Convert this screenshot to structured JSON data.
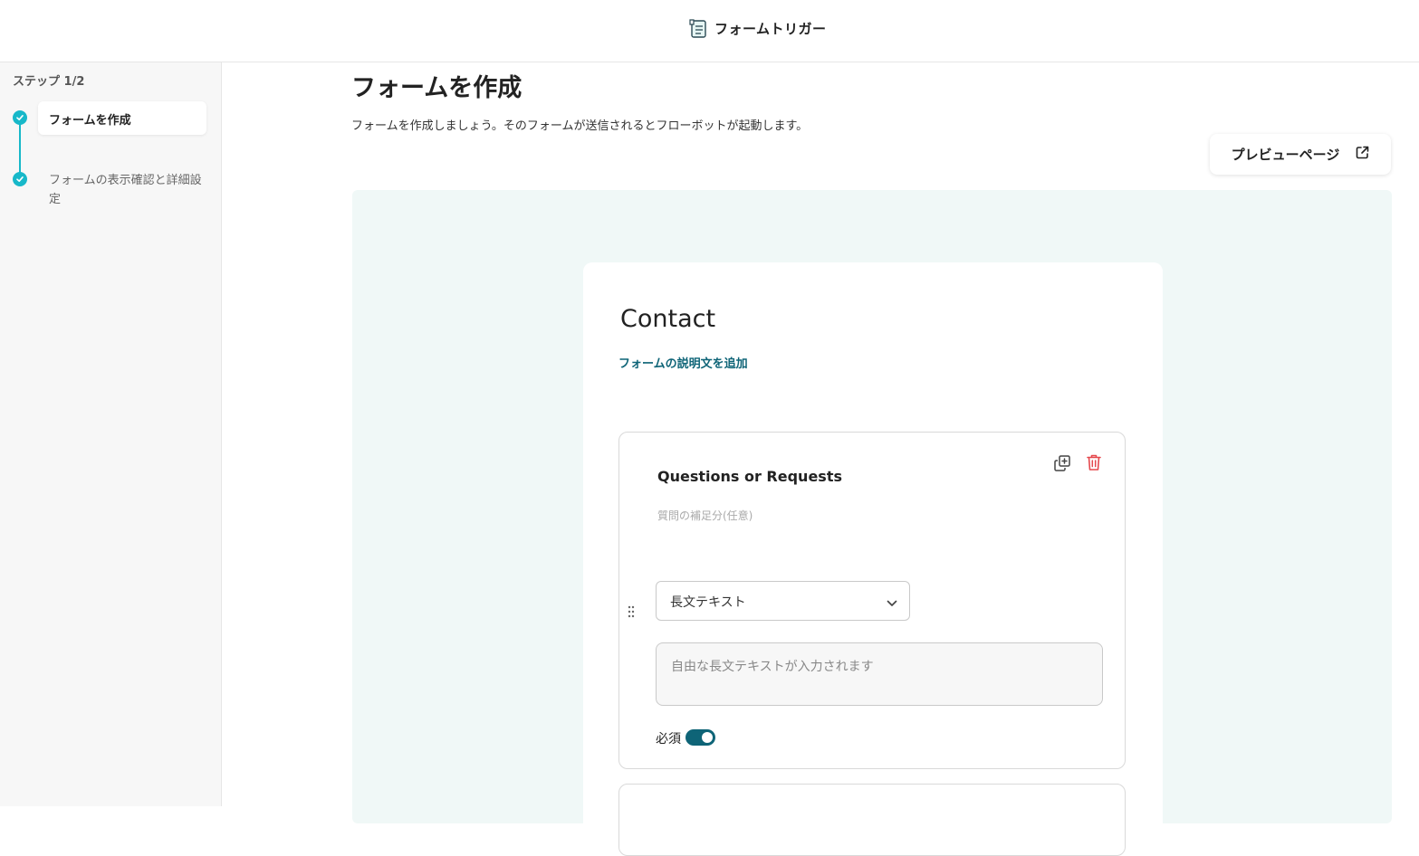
{
  "header": {
    "title": "フォームトリガー",
    "icon": "form-document-icon"
  },
  "sidebar": {
    "step_count": "ステップ 1/2",
    "steps": [
      {
        "label": "フォームを作成",
        "status": "active"
      },
      {
        "label": "フォームの表示確認と詳細設定",
        "status": "done"
      }
    ]
  },
  "main": {
    "title": "フォームを作成",
    "description": "フォームを作成しましょう。そのフォームが送信されるとフローボットが起動します。",
    "preview_button": "プレビューページ"
  },
  "form": {
    "title": "Contact",
    "add_description": "フォームの説明文を追加",
    "questions": [
      {
        "title": "Questions or Requests",
        "subtitle_placeholder": "質問の補足分(任意)",
        "type": "長文テキスト",
        "answer_placeholder": "自由な長文テキストが入力されます",
        "required_label": "必須",
        "required": true
      }
    ]
  },
  "colors": {
    "accent": "#17b8c9",
    "primary": "#0e6477",
    "danger": "#e5484d",
    "canvas": "#f0f8f7"
  }
}
